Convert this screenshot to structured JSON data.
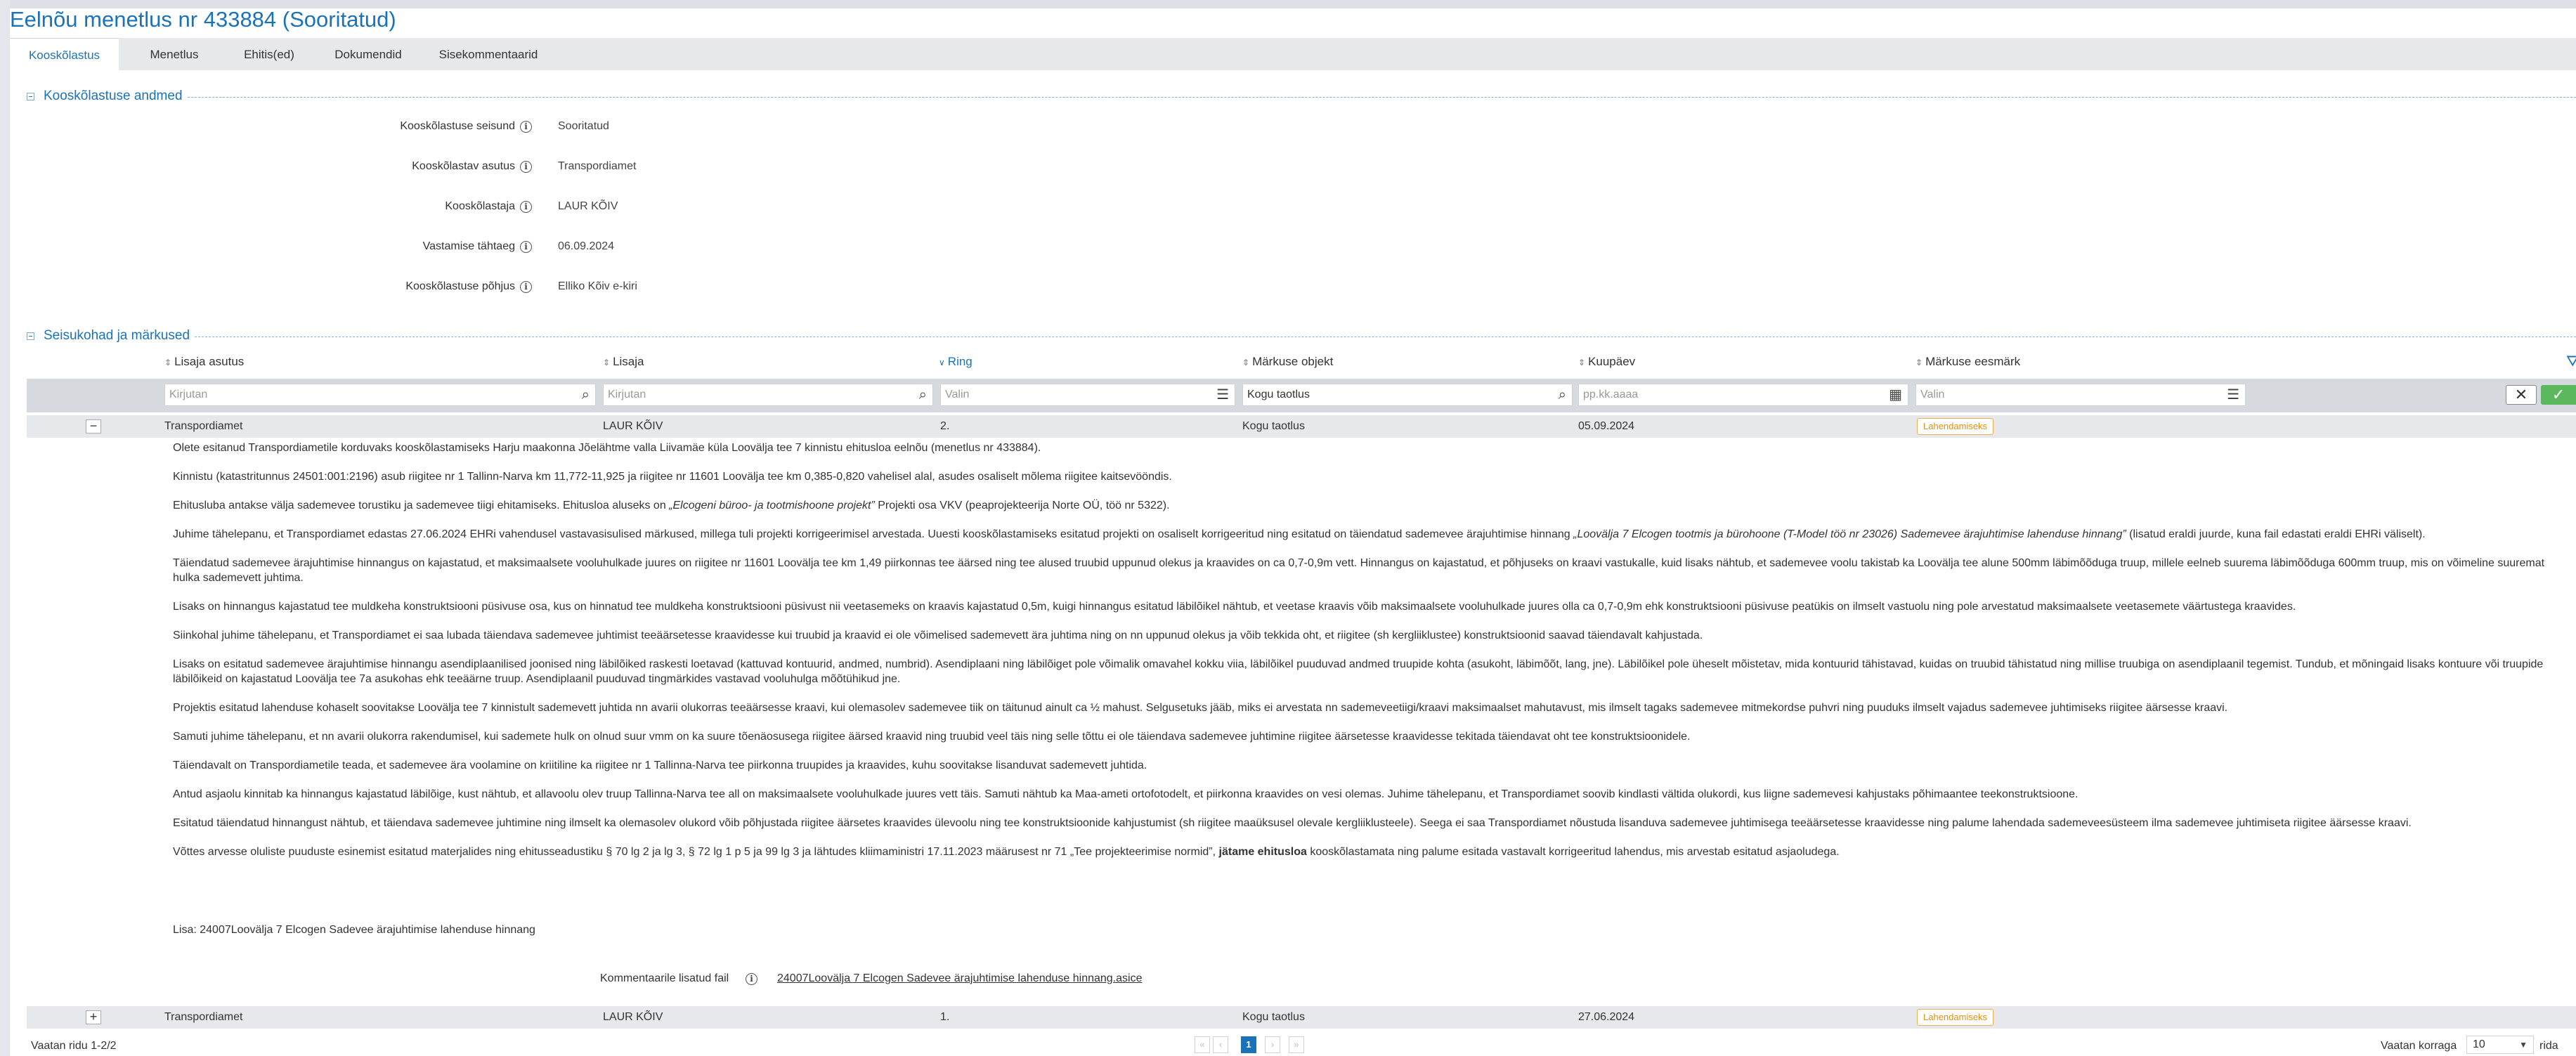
{
  "page": {
    "title": "Eelnõu menetlus nr 433884 (Sooritatud)"
  },
  "tabs": [
    {
      "label": "Kooskõlastus",
      "active": true
    },
    {
      "label": "Menetlus"
    },
    {
      "label": "Ehitis(ed)"
    },
    {
      "label": "Dokumendid"
    },
    {
      "label": "Sisekommentaarid"
    }
  ],
  "section1": {
    "title": "Kooskõlastuse andmed",
    "fields": [
      {
        "label": "Kooskõlastuse seisund",
        "value": "Sooritatud"
      },
      {
        "label": "Kooskõlastav asutus",
        "value": "Transpordiamet"
      },
      {
        "label": "Kooskõlastaja",
        "value": "LAUR KÕIV"
      },
      {
        "label": "Vastamise tähtaeg",
        "value": "06.09.2024"
      },
      {
        "label": "Kooskõlastuse põhjus",
        "value": "Elliko Kõiv e-kiri"
      }
    ]
  },
  "section2": {
    "title": "Seisukohad ja märkused"
  },
  "table": {
    "columns": [
      "Lisaja asutus",
      "Lisaja",
      "Ring",
      "Märkuse objekt",
      "Kuupäev",
      "Märkuse eesmärk"
    ],
    "sorted_column": "Ring",
    "filters": {
      "asutus_placeholder": "Kirjutan",
      "lisaja_placeholder": "Kirjutan",
      "ring_placeholder": "Valin",
      "objekt_value": "Kogu taotlus",
      "kuupaev_placeholder": "pp.kk.aaaa",
      "eesmark_placeholder": "Valin"
    },
    "rows": [
      {
        "asutus": "Transpordiamet",
        "lisaja": "LAUR KÕIV",
        "ring": "2.",
        "objekt": "Kogu taotlus",
        "kuupaev": "05.09.2024",
        "eesmark": "Lahendamiseks",
        "expanded": true
      },
      {
        "asutus": "Transpordiamet",
        "lisaja": "LAUR KÕIV",
        "ring": "1.",
        "objekt": "Kogu taotlus",
        "kuupaev": "27.06.2024",
        "eesmark": "Lahendamiseks",
        "expanded": false
      }
    ]
  },
  "detail": {
    "paragraphs": [
      "Olete esitanud Transpordiametile korduvaks kooskõlastamiseks Harju maakonna Jõelähtme valla Liivamäe küla Loovälja tee 7 kinnistu ehitusloa eelnõu (menetlus nr 433884).",
      "Kinnistu (katastritunnus 24501:001:2196) asub riigitee nr 1 Tallinn-Narva km 11,772-11,925 ja riigitee nr 11601 Loovälja tee km 0,385-0,820 vahelisel alal, asudes osaliselt mõlema riigitee kaitsevööndis.",
      "Juhime tähelepanu, et Transpordiamet edastas 27.06.2024 EHRi vahendusel vastavasisulised märkused, millega tuli projekti korrigeerimisel arvestada. Uuesti kooskõlastamiseks esitatud projekti on osaliselt korrigeeritud ning esitatud on täiendatud sademevee ärajuhtimise hinnang",
      "Täiendatud sademevee ärajuhtimise hinnangus on kajastatud, et maksimaalsete vooluhulkade juures on riigitee nr 11601 Loovälja tee km 1,49 piirkonnas tee äärsed ning tee alused truubid uppunud olekus ja kraavides on ca 0,7-0,9m vett. Hinnangus on kajastatud, et põhjuseks on kraavi vastukalle, kuid lisaks nähtub, et sademevee voolu takistab ka Loovälja tee alune 500mm läbimõõduga truup, millele eelneb suurema läbimõõduga 600mm truup, mis on võimeline suuremat hulka sademevett juhtima.",
      "Lisaks on hinnangus kajastatud tee muldkeha konstruktsiooni püsivuse osa, kus on hinnatud tee muldkeha konstruktsiooni püsivust nii veetasemeks on kraavis kajastatud 0,5m, kuigi hinnangus esitatud läbilõikel nähtub, et veetase kraavis võib maksimaalsete vooluhulkade juures olla ca 0,7-0,9m ehk konstruktsiooni püsivuse peatükis on ilmselt vastuolu ning pole arvestatud maksimaalsete veetasemete väärtustega kraavides.",
      "Siinkohal juhime tähelepanu, et Transpordiamet ei saa lubada täiendava sademevee juhtimist teeäärsetesse kraavidesse kui truubid ja kraavid ei ole võimelised sademevett ära juhtima ning on nn uppunud olekus ja võib tekkida oht, et riigitee (sh kergliiklustee) konstruktsioonid saavad täiendavalt kahjustada.",
      "Lisaks on esitatud sademevee ärajuhtimise hinnangu asendiplaanilised joonised ning läbilõiked raskesti loetavad (kattuvad kontuurid, andmed, numbrid). Asendiplaani ning läbilõiget pole võimalik omavahel kokku viia, läbilõikel puuduvad andmed truupide kohta (asukoht, läbimõõt, lang, jne). Läbilõikel pole üheselt mõistetav, mida kontuurid tähistavad, kuidas on truubid tähistatud ning millise truubiga on asendiplaanil tegemist. Tundub, et mõningaid lisaks kontuure või truupide läbilõikeid on kajastatud Loovälja tee 7a asukohas ehk teeäärne truup. Asendiplaanil puuduvad tingmärkides vastavad vooluhulga mõõtühikud jne.",
      "Projektis esitatud lahenduse kohaselt soovitakse Loovälja tee 7 kinnistult sademevett juhtida nn avarii olukorras teeäärsesse kraavi, kui olemasolev sademevee tiik on täitunud ainult ca ½ mahust. Selgusetuks jääb, miks ei arvestata nn sademeveetiigi/kraavi maksimaalset mahutavust, mis ilmselt tagaks sademevee mitmekordse puhvri ning puuduks ilmselt vajadus sademevee juhtimiseks riigitee äärsesse kraavi.",
      "Samuti juhime tähelepanu, et nn avarii olukorra rakendumisel, kui sademete hulk on olnud suur vmm on ka suure tõenäosusega riigitee äärsed kraavid ning truubid veel täis ning selle tõttu ei ole täiendava sademevee juhtimine riigitee äärsetesse kraavidesse tekitada täiendavat oht tee konstruktsioonidele.",
      "Täiendavalt on Transpordiametile teada, et sademevee ära voolamine on kriitiline ka riigitee nr 1 Tallinna-Narva tee piirkonna truupides ja kraavides, kuhu soovitakse lisanduvat sademevett juhtida.",
      "Antud asjaolu kinnitab ka hinnangus kajastatud läbilõige, kust nähtub, et allavoolu olev truup Tallinna-Narva tee all on maksimaalsete vooluhulkade juures vett täis. Samuti nähtub ka Maa-ameti ortofotodelt, et piirkonna kraavides on vesi olemas. Juhime tähelepanu, et Transpordiamet soovib kindlasti vältida olukordi, kus liigne sademevesi kahjustaks põhimaantee teekonstruktsioone.",
      "Esitatud täiendatud hinnangust nähtub, et täiendava sademevee juhtimine ning ilmselt ka olemasolev olukord võib põhjustada riigitee äärsetes kraavides ülevoolu ning tee konstruktsioonide kahjustumist (sh riigitee maaüksusel olevale kergliiklusteele). Seega ei saa Transpordiamet nõustuda lisanduva sademevee juhtimisega teeäärsetesse kraavidesse ning palume lahendada sademeveesüsteem ilma sademevee juhtimiseta riigitee äärsesse kraavi."
    ],
    "p3_prefix": "Ehitusluba antakse välja sademevee torustiku ja sademevee tiigi ehitamiseks. Ehitusloa aluseks on ",
    "p3_italic": "„Elcogeni büroo- ja tootmishoone projekt”",
    "p3_suffix": " Projekti osa VKV (peaprojekteerija Norte OÜ, töö nr 5322).",
    "p4_italic": "„Loovälja 7 Elcogen tootmis ja bürohoone (T-Model töö nr 23026) Sademevee ärajuhtimise lahenduse hinnang”",
    "p4_suffix": " (lisatud eraldi juurde, kuna fail edastati eraldi EHRi väliselt).",
    "final_prefix": "Võttes arvesse oluliste puuduste esinemist esitatud materjalides ning ehitusseadustiku § 70 lg 2 ja lg 3, § 72 lg 1 p 5 ja 99 lg 3 ja lähtudes kliimaministri 17.11.2023 määrusest nr 71 „Tee projekteerimise normid”, ",
    "final_bold": "jätame ehitusloa",
    "final_suffix": " kooskõlastamata ning palume esitada vastavalt korrigeeritud lahendus, mis arvestab esitatud asjaoludega.",
    "lisa_label": "Lisa:",
    "lisa_text": "24007Loovälja 7 Elcogen Sadevee ärajuhtimise lahenduse hinnang",
    "file_label": "Kommentaarile lisatud fail",
    "file_name": "24007Loovälja 7 Elcogen Sadevee ärajuhtimise lahenduse hinnang.asice"
  },
  "footer": {
    "count": "Vaatan ridu 1-2/2",
    "current_page": "1",
    "per_page_label": "Vaatan korraga",
    "per_page_value": "10",
    "per_page_suffix": "rida"
  }
}
